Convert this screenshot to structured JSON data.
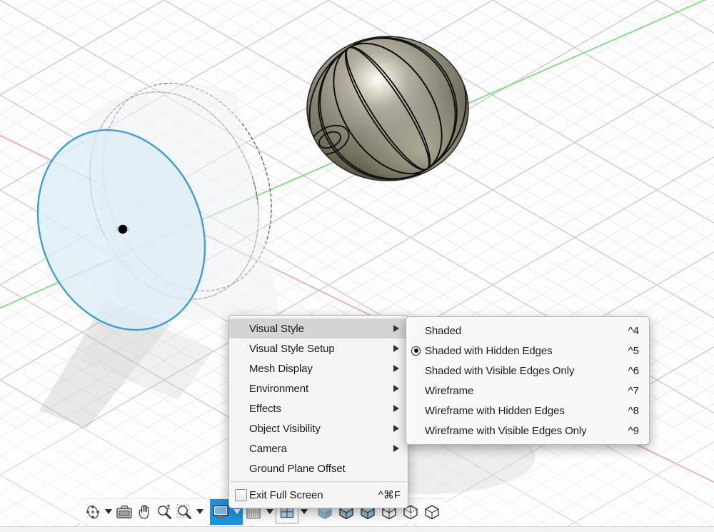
{
  "app": {
    "name": "CAD 3D Modeling Viewport",
    "background_color": "#fdfdfd"
  },
  "viewport": {
    "name": "3d-viewport",
    "grid": {
      "style": "isometric",
      "minor_color": "#e8e8e8",
      "major_color": "#cccccc"
    },
    "axes": [
      {
        "name": "x-axis",
        "color": "#e8a0a0"
      },
      {
        "name": "y-axis",
        "color": "#7ede7e"
      }
    ],
    "objects": [
      {
        "name": "sphere",
        "label": "Shaded Sphere",
        "fill": "#8a8676",
        "edge_color": "#1a1a1a"
      },
      {
        "name": "selected-circle-sketch",
        "label": "Selected Circle",
        "stroke": "#3a9fd4",
        "fill": "#dff0f7"
      },
      {
        "name": "hidden-edge-ellipses",
        "label": "Hidden Edge Wireframe",
        "stroke": "#555555"
      },
      {
        "name": "origin-point",
        "label": "Origin Point",
        "color": "#000000"
      }
    ]
  },
  "context_menu": {
    "name": "view-context-menu",
    "items": [
      {
        "label": "Visual Style",
        "submenu": true,
        "highlighted": true,
        "shortcut": ""
      },
      {
        "label": "Visual Style Setup",
        "submenu": true,
        "highlighted": false,
        "shortcut": ""
      },
      {
        "label": "Mesh Display",
        "submenu": true,
        "highlighted": false,
        "shortcut": ""
      },
      {
        "label": "Environment",
        "submenu": true,
        "highlighted": false,
        "shortcut": ""
      },
      {
        "label": "Effects",
        "submenu": true,
        "highlighted": false,
        "shortcut": ""
      },
      {
        "label": "Object Visibility",
        "submenu": true,
        "highlighted": false,
        "shortcut": ""
      },
      {
        "label": "Camera",
        "submenu": true,
        "highlighted": false,
        "shortcut": ""
      },
      {
        "label": "Ground Plane Offset",
        "submenu": false,
        "highlighted": false,
        "shortcut": ""
      }
    ],
    "footer_item": {
      "label": "Exit Full Screen",
      "shortcut": "^⌘F",
      "checkbox": true,
      "checked": false
    }
  },
  "submenu": {
    "name": "visual-style-submenu",
    "parent": "Visual Style",
    "items": [
      {
        "label": "Shaded",
        "shortcut": "^4",
        "selected": false
      },
      {
        "label": "Shaded with Hidden Edges",
        "shortcut": "^5",
        "selected": true
      },
      {
        "label": "Shaded with Visible Edges Only",
        "shortcut": "^6",
        "selected": false
      },
      {
        "label": "Wireframe",
        "shortcut": "^7",
        "selected": false
      },
      {
        "label": "Wireframe with Hidden Edges",
        "shortcut": "^8",
        "selected": false
      },
      {
        "label": "Wireframe with Visible Edges Only",
        "shortcut": "^9",
        "selected": false
      }
    ]
  },
  "toolbar": {
    "name": "view-toolbar",
    "active_color": "#1d93db",
    "groups": [
      {
        "name": "navigation",
        "buttons": [
          {
            "icon": "orbit-icon",
            "label": "Orbit",
            "dropdown": true,
            "active": false
          },
          {
            "icon": "look-at-icon",
            "label": "Look At",
            "dropdown": false,
            "active": false
          },
          {
            "icon": "pan-hand-icon",
            "label": "Pan",
            "dropdown": false,
            "active": false
          },
          {
            "icon": "zoom-magnifier-icon",
            "label": "Zoom",
            "dropdown": false,
            "active": false
          },
          {
            "icon": "zoom-window-icon",
            "label": "Zoom Window",
            "dropdown": true,
            "active": false
          }
        ]
      },
      {
        "name": "display",
        "buttons": [
          {
            "icon": "display-monitor-icon",
            "label": "Display Settings",
            "dropdown": true,
            "active": true
          },
          {
            "icon": "grid-icon",
            "label": "Grids and Snaps",
            "dropdown": true,
            "active": false
          },
          {
            "icon": "viewports-icon",
            "label": "Viewports",
            "dropdown": true,
            "active": false
          }
        ]
      },
      {
        "name": "visual-style-quick",
        "buttons": [
          {
            "icon": "cube-shaded-icon",
            "label": "Shaded",
            "dropdown": false,
            "active": false
          },
          {
            "icon": "cube-shaded-hidden-edges-icon",
            "label": "Shaded with Hidden Edges",
            "dropdown": false,
            "active": false
          },
          {
            "icon": "cube-shaded-visible-edges-icon",
            "label": "Shaded with Visible Edges Only",
            "dropdown": false,
            "active": false
          },
          {
            "icon": "cube-wireframe-icon",
            "label": "Wireframe",
            "dropdown": false,
            "active": false
          },
          {
            "icon": "cube-wireframe-hidden-icon",
            "label": "Wireframe with Hidden Edges",
            "dropdown": false,
            "active": false
          },
          {
            "icon": "cube-wireframe-visible-icon",
            "label": "Wireframe with Visible Edges Only",
            "dropdown": false,
            "active": false
          }
        ]
      }
    ]
  }
}
